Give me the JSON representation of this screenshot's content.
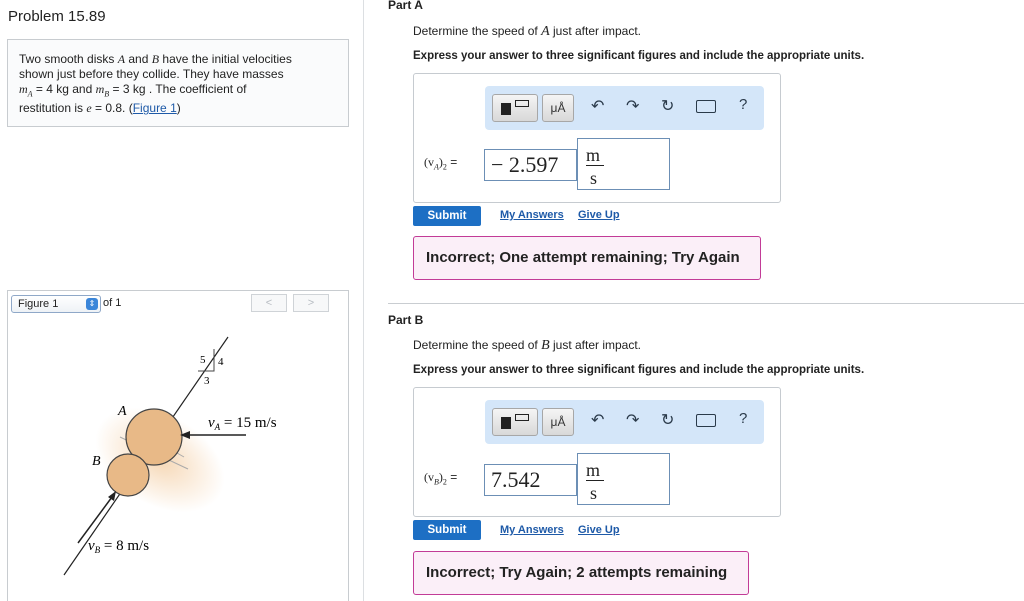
{
  "problem": {
    "title": "Problem 15.89",
    "text_line1a": "Two smooth disks ",
    "text_A": "A",
    "text_and": " and ",
    "text_B": "B",
    "text_line1b": " have the initial velocities",
    "text_line2": "shown just before they collide. They have masses",
    "mA_label": "m",
    "mA_sub": "A",
    "mA_value": " = 4  kg and ",
    "mB_label": "m",
    "mB_sub": "B",
    "mB_value": " = 3  kg",
    "text_line3b": " . The coefficient of",
    "text_line4a": "restitution is ",
    "e_sym": "e",
    "e_value": " = 0.8. (",
    "figure_link": "Figure 1",
    "close_paren": ")"
  },
  "figure": {
    "select_value": "Figure 1",
    "of_label": "of 1",
    "prev": "<",
    "next": ">",
    "label_A": "A",
    "label_B": "B",
    "slope_5": "5",
    "slope_4": "4",
    "slope_3": "3",
    "vA_label": "v",
    "vA_sub": "A",
    "vA_value": " = 15 m/s",
    "vB_label": "v",
    "vB_sub": "B",
    "vB_value": " = 8 m/s"
  },
  "partA": {
    "title": "Part A",
    "prompt_pre": "Determine the speed of ",
    "prompt_var": "A",
    "prompt_post": " just after impact.",
    "instructions": "Express your answer to three significant figures and include the appropriate units.",
    "var_label": "(v",
    "var_sub": "A",
    "var_close": ")",
    "var_sub2": "2",
    "equals": " =",
    "value": "− 2.597",
    "unit_num": "m",
    "unit_den": "s",
    "submit": "Submit",
    "my_answers": "My Answers",
    "give_up": "Give Up",
    "feedback": "Incorrect; One attempt remaining; Try Again"
  },
  "partB": {
    "title": "Part B",
    "prompt_pre": "Determine the speed of ",
    "prompt_var": "B",
    "prompt_post": " just after impact.",
    "instructions": "Express your answer to three significant figures and include the appropriate units.",
    "var_label": "(v",
    "var_sub": "B",
    "var_close": ")",
    "var_sub2": "2",
    "equals": " =",
    "value": "7.542",
    "unit_num": "m",
    "unit_den": "s",
    "submit": "Submit",
    "my_answers": "My Answers",
    "give_up": "Give Up",
    "feedback": "Incorrect; Try Again; 2 attempts remaining"
  },
  "toolbar": {
    "units_button": "μÅ",
    "help": "?",
    "icons": [
      "templates-icon",
      "units-icon",
      "undo-icon",
      "redo-icon",
      "reset-icon",
      "keyboard-icon",
      "help-icon"
    ]
  },
  "colors": {
    "submit_bg": "#1d6fc4",
    "link": "#1e5aa8",
    "feedback_border": "#c23b97",
    "feedback_bg": "#fbeff8",
    "toolbar_bg": "#d4e6f9",
    "disk_fill": "#e8b987"
  }
}
